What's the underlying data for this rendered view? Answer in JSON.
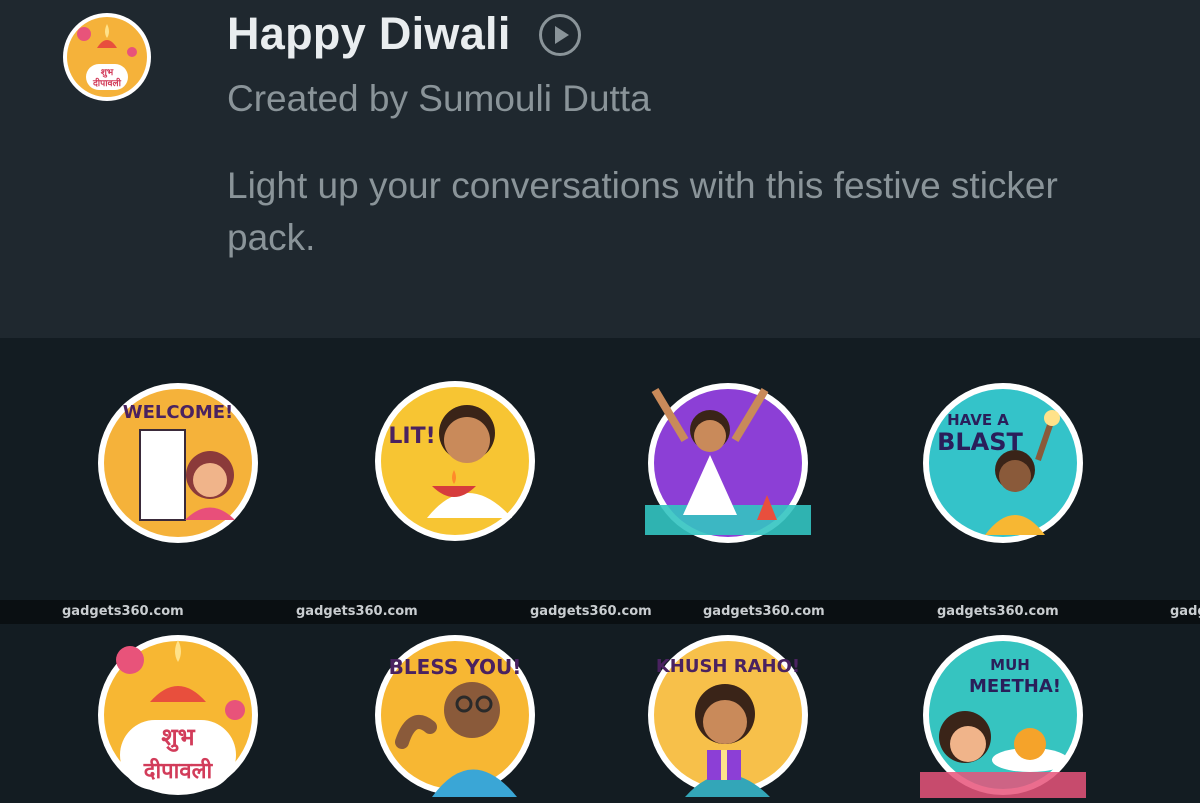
{
  "pack": {
    "title": "Happy Diwali",
    "author": "Created by Sumouli Dutta",
    "description": "Light up your conversations with this festive sticker pack.",
    "icon_text_line1": "शुभ",
    "icon_text_line2": "दीपावली"
  },
  "stickers": [
    {
      "text": "WELCOME!",
      "bg": "#f5b23a"
    },
    {
      "text": "LIT!",
      "bg": "#f7c533"
    },
    {
      "text": "",
      "bg": "#8c3fd6"
    },
    {
      "text_line1": "HAVE A",
      "text_line2": "BLAST",
      "bg": "#34c3c9"
    },
    {
      "text_line1": "शुभ",
      "text_line2": "दीपावली",
      "bg": "#f7b733"
    },
    {
      "text": "BLESS YOU!",
      "bg": "#f7b733"
    },
    {
      "text": "KHUSH RAHO!",
      "bg": "#f7c04a"
    },
    {
      "text_line1": "MUH",
      "text_line2": "MEETHA!",
      "bg": "#36c4c0"
    }
  ],
  "watermark": "gadgets360.com",
  "watermark_edge": "gadg",
  "colors": {
    "header_bg": "#1f282f",
    "body_bg": "#131c22",
    "title": "#e9edef",
    "secondary_text": "#8a9499"
  }
}
